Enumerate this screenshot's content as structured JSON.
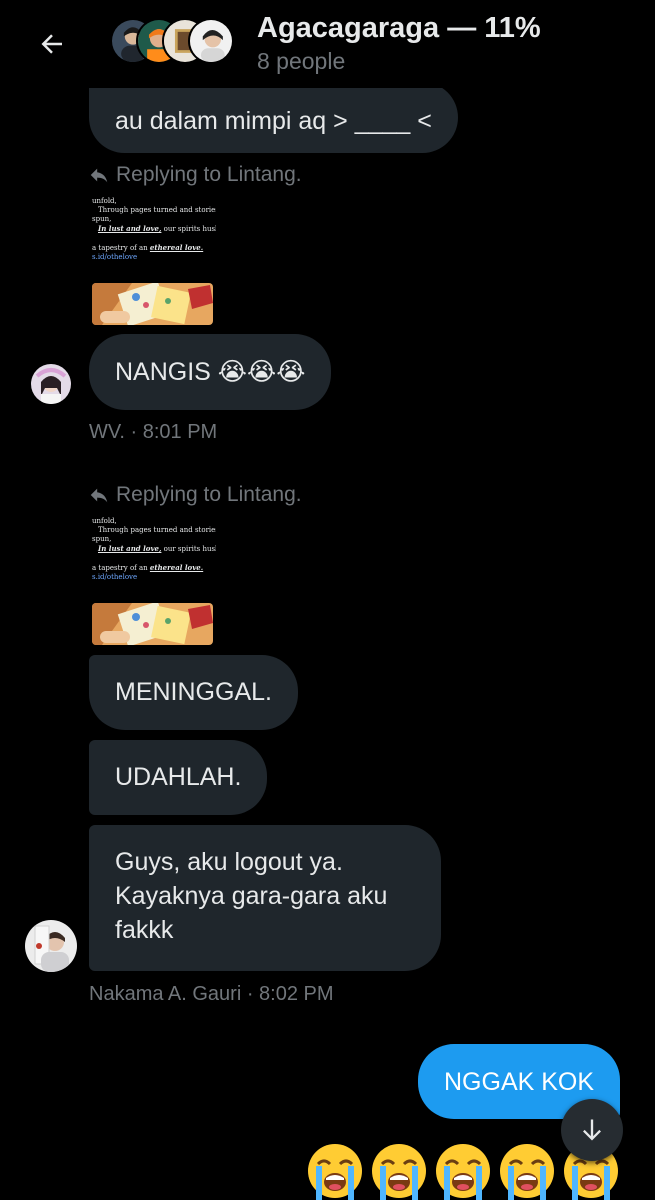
{
  "header": {
    "back_icon": "arrow-left-icon",
    "title": "Agacagaraga — 11%",
    "subtitle": "8 people"
  },
  "colors": {
    "background": "#000000",
    "received_bubble": "#1f262c",
    "sent_bubble": "#1d9bf0",
    "secondary_text": "#71767b",
    "primary_text": "#e7e9ea"
  },
  "messages": [
    {
      "text": "au dalam mimpi aq > ____ <",
      "direction": "received"
    },
    {
      "reply_label": "Replying to Lintang.",
      "quoted_lines": [
        "unfold,",
        "Through pages turned and stories",
        "spun,",
        "In lust and love,",
        " our spirits husk.",
        "a tapestry of an ",
        "ethereal love.",
        "s.id/othelove"
      ],
      "text": "NANGIS 😭😭😭",
      "direction": "received",
      "sender_meta": "WV. · 8:01 PM"
    },
    {
      "reply_label": "Replying to Lintang.",
      "quoted_lines": [
        "unfold,",
        "Through pages turned and stories",
        "spun,",
        "In lust and love,",
        " our spirits husk.",
        "a tapestry of an ",
        "ethereal love.",
        "s.id/othelove"
      ],
      "text": "MENINGGAL.",
      "direction": "received"
    },
    {
      "text": "UDAHLAH.",
      "direction": "received"
    },
    {
      "text": "Guys, aku logout ya.\nKayaknya gara-gara aku\nfakkk",
      "direction": "received",
      "sender_meta": "Nakama A. Gauri · 8:02 PM"
    },
    {
      "text": "NGGAK KOK",
      "direction": "sent"
    },
    {
      "emoji": "😭😭😭😭😭",
      "emoji_icon": "loudly-crying-face-icon",
      "direction": "sent"
    }
  ],
  "scroll_button": {
    "icon": "arrow-down-icon"
  }
}
